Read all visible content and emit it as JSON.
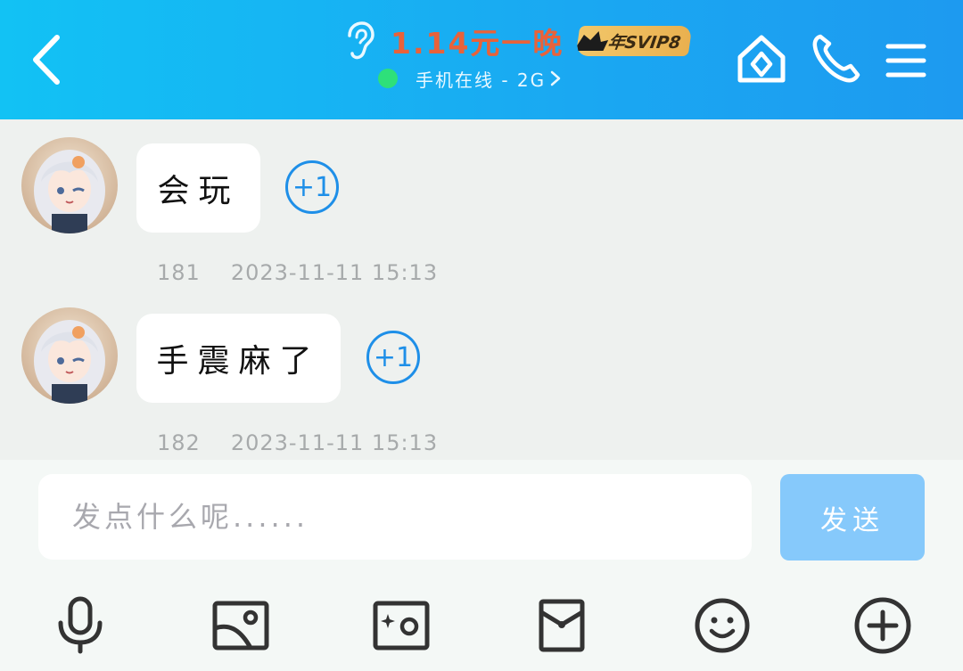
{
  "header": {
    "title": "1.14元一晚",
    "badge": "年SVIP8",
    "status": "手机在线 - 2G",
    "colors": {
      "title": "#e8623a",
      "background": "#1aa8f2",
      "online": "#2ee07a"
    }
  },
  "messages": [
    {
      "text": "会玩",
      "reaction": "+1",
      "number": "181",
      "timestamp": "2023-11-11 15:13"
    },
    {
      "text": "手震麻了",
      "reaction": "+1",
      "number": "182",
      "timestamp": "2023-11-11 15:13"
    }
  ],
  "composer": {
    "placeholder": "发点什么呢......",
    "send_label": "发送"
  },
  "toolbar": {
    "icons": [
      "microphone-icon",
      "image-icon",
      "camera-icon",
      "red-packet-icon",
      "emoji-icon",
      "plus-icon"
    ]
  }
}
